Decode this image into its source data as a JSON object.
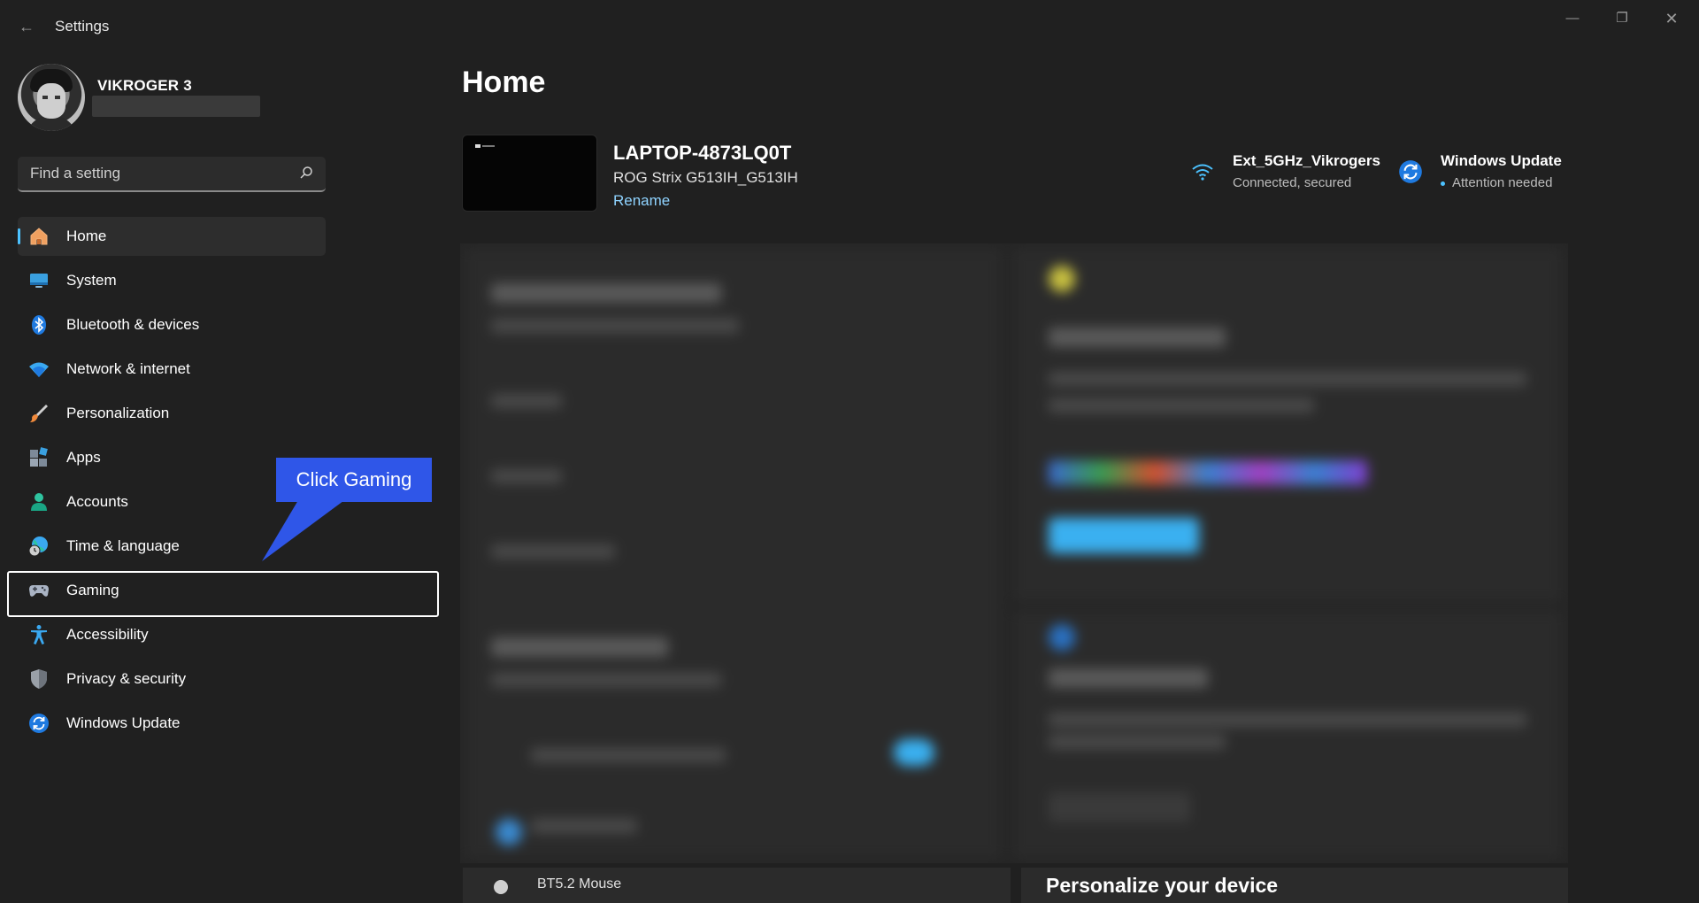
{
  "window": {
    "title": "Settings",
    "controls": {
      "minimize": "—",
      "maximize": "❐",
      "close": "✕"
    }
  },
  "profile": {
    "name": "VIKROGER 3"
  },
  "search": {
    "placeholder": "Find a setting"
  },
  "sidebar": {
    "items": [
      {
        "label": "Home",
        "icon": "home-icon",
        "active": true
      },
      {
        "label": "System",
        "icon": "system-icon"
      },
      {
        "label": "Bluetooth & devices",
        "icon": "bluetooth-icon"
      },
      {
        "label": "Network & internet",
        "icon": "wifi-icon"
      },
      {
        "label": "Personalization",
        "icon": "brush-icon"
      },
      {
        "label": "Apps",
        "icon": "apps-icon"
      },
      {
        "label": "Accounts",
        "icon": "account-icon"
      },
      {
        "label": "Time & language",
        "icon": "globe-clock-icon"
      },
      {
        "label": "Gaming",
        "icon": "gamepad-icon",
        "highlighted": true
      },
      {
        "label": "Accessibility",
        "icon": "accessibility-icon"
      },
      {
        "label": "Privacy & security",
        "icon": "shield-icon"
      },
      {
        "label": "Windows Update",
        "icon": "update-icon"
      }
    ]
  },
  "callout": {
    "text": "Click Gaming",
    "color": "#2f56e8"
  },
  "main": {
    "title": "Home",
    "device": {
      "name": "LAPTOP-4873LQ0T",
      "model": "ROG Strix G513IH_G513IH",
      "rename": "Rename"
    },
    "status": {
      "network": {
        "title": "Ext_5GHz_Vikrogers",
        "subtitle": "Connected, secured"
      },
      "update": {
        "title": "Windows Update",
        "subtitle": "Attention needed"
      }
    },
    "bottom": {
      "left_item": "BT5.2 Mouse",
      "right_title": "Personalize your device"
    }
  },
  "colors": {
    "accent": "#4cc2ff",
    "background": "#202020",
    "sidebar_active": "#2d2d2d"
  }
}
